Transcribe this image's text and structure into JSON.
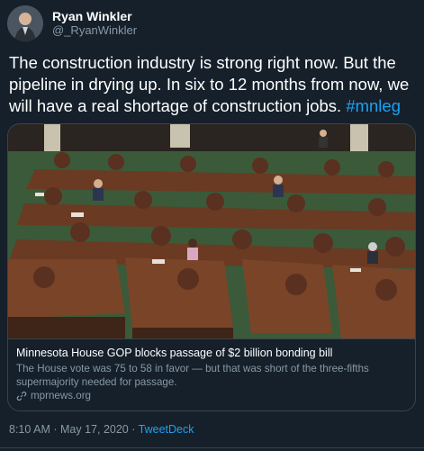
{
  "author": {
    "display_name": "Ryan Winkler",
    "handle": "@_RyanWinkler"
  },
  "tweet": {
    "text": "The construction industry is strong right now. But the pipeline in drying up. In six to 12 months from now, we will have a real shortage of construction jobs.",
    "hashtag": "#mnleg"
  },
  "card": {
    "title": "Minnesota House GOP blocks passage of $2 billion bonding bill",
    "description": "The House vote was 75 to 58 in favor — but that was short of the three-fifths supermajority needed for passage.",
    "domain": "mprnews.org"
  },
  "meta": {
    "time": "8:10 AM",
    "separator": "·",
    "date": "May 17, 2020",
    "source": "TweetDeck"
  },
  "colors": {
    "background": "#15202b",
    "link": "#1da1f2",
    "muted": "#8899a6",
    "border": "#38444d"
  },
  "icons": {
    "link": "link-icon"
  }
}
